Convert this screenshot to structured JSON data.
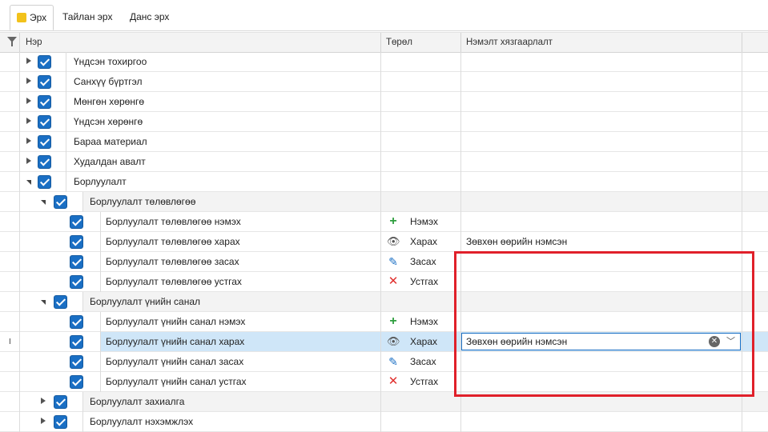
{
  "tabs": [
    {
      "label": "Эрх",
      "active": true
    },
    {
      "label": "Тайлан эрх",
      "active": false
    },
    {
      "label": "Данс эрх",
      "active": false
    }
  ],
  "columns": {
    "name": "Нэр",
    "type": "Төрөл",
    "extra": "Нэмэлт хязгаарлалт"
  },
  "rows": [
    {
      "level": 0,
      "expander": "collapsed",
      "name": "Үндсэн тохиргоо"
    },
    {
      "level": 0,
      "expander": "collapsed",
      "name": "Санхүү бүртгэл"
    },
    {
      "level": 0,
      "expander": "collapsed",
      "name": "Мөнгөн хөрөнгө"
    },
    {
      "level": 0,
      "expander": "collapsed",
      "name": "Үндсэн хөрөнгө"
    },
    {
      "level": 0,
      "expander": "collapsed",
      "name": "Бараа материал"
    },
    {
      "level": 0,
      "expander": "collapsed",
      "name": "Худалдан авалт"
    },
    {
      "level": 0,
      "expander": "expanded",
      "name": "Борлуулалт"
    },
    {
      "level": 1,
      "expander": "expanded",
      "name": "Борлуулалт төлөвлөгөө",
      "group": true
    },
    {
      "level": 2,
      "name": "Борлуулалт төлөвлөгөө нэмэх",
      "type_icon": "plus-icon",
      "type": "Нэмэх",
      "extra": ""
    },
    {
      "level": 2,
      "name": "Борлуулалт төлөвлөгөө харах",
      "type_icon": "eye-icon",
      "type": "Харах",
      "extra": "Зөвхөн өөрийн нэмсэн"
    },
    {
      "level": 2,
      "name": "Борлуулалт төлөвлөгөө засах",
      "type_icon": "pencil-icon",
      "type": "Засах",
      "extra": ""
    },
    {
      "level": 2,
      "name": "Борлуулалт төлөвлөгөө устгах",
      "type_icon": "close-x-icon",
      "type": "Устгах",
      "extra": ""
    },
    {
      "level": 1,
      "expander": "expanded",
      "name": "Борлуулалт үнийн санал",
      "group": true
    },
    {
      "level": 2,
      "name": "Борлуулалт үнийн санал нэмэх",
      "type_icon": "plus-icon",
      "type": "Нэмэх",
      "extra": ""
    },
    {
      "level": 2,
      "name": "Борлуулалт үнийн санал харах",
      "type_icon": "eye-icon",
      "type": "Харах",
      "extra": "Зөвхөн өөрийн нэмсэн",
      "selected": true,
      "editing": true
    },
    {
      "level": 2,
      "name": "Борлуулалт үнийн санал засах",
      "type_icon": "pencil-icon",
      "type": "Засах",
      "extra": ""
    },
    {
      "level": 2,
      "name": "Борлуулалт үнийн санал устгах",
      "type_icon": "close-x-icon",
      "type": "Устгах",
      "extra": ""
    },
    {
      "level": 1,
      "expander": "collapsed",
      "name": "Борлуулалт захиалга",
      "group": true
    },
    {
      "level": 1,
      "expander": "collapsed",
      "name": "Борлуулалт нэхэмжлэх"
    }
  ],
  "colors": {
    "accent": "#1a6fc4",
    "selection": "#cfe6f8",
    "highlight_box": "#e0202a"
  }
}
